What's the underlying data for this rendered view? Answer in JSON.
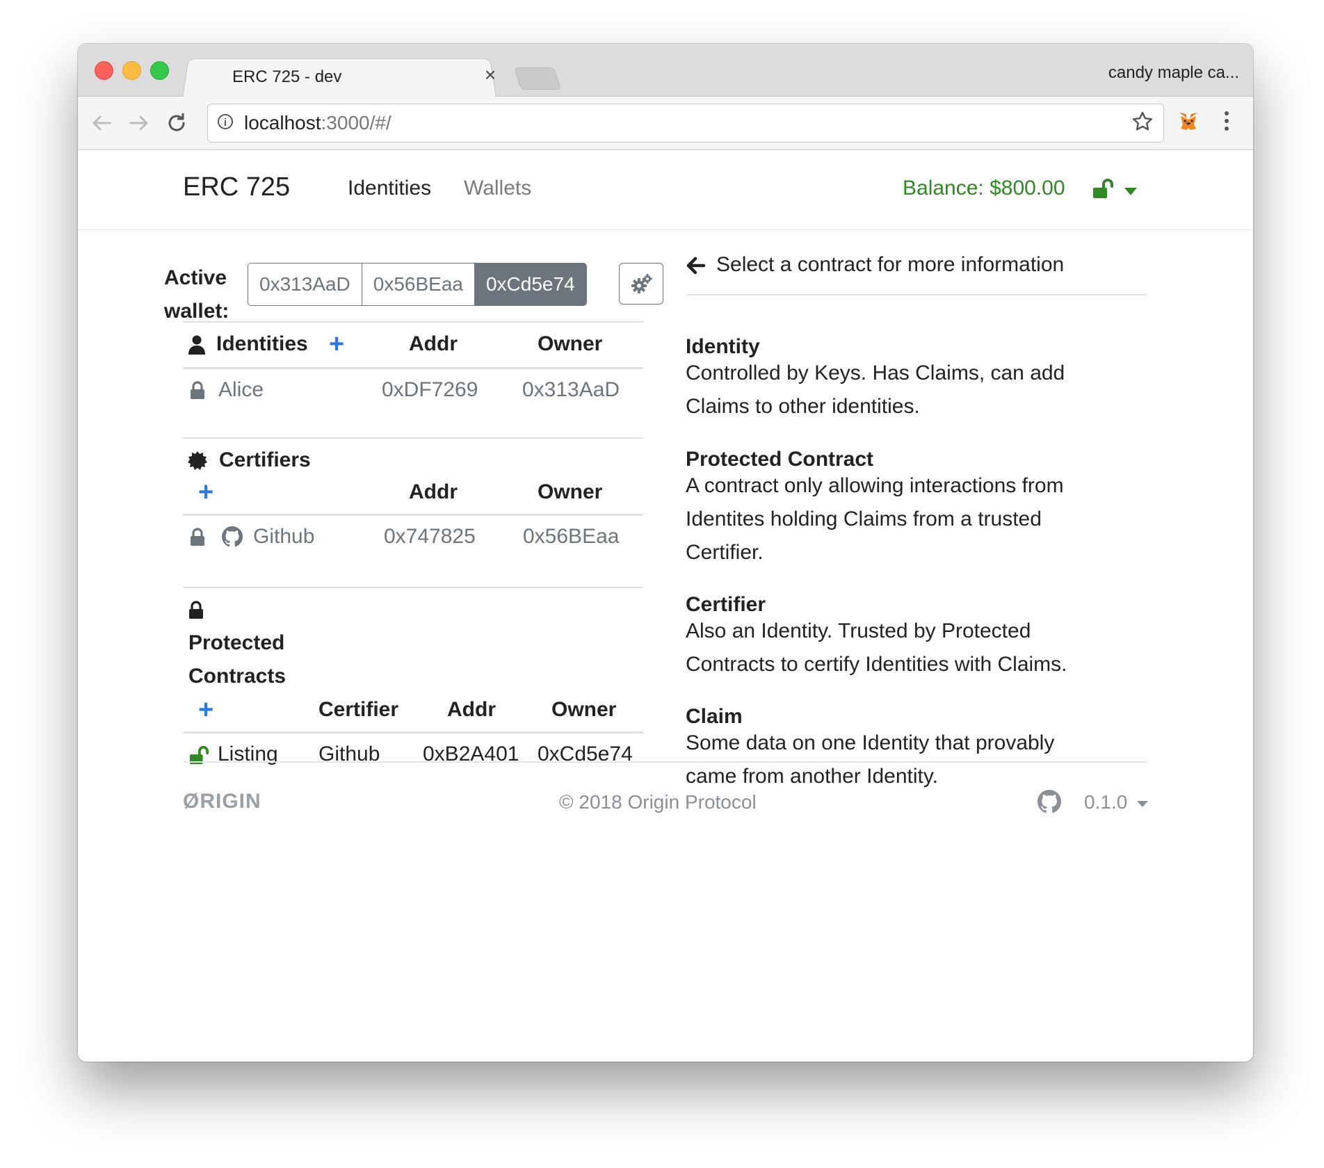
{
  "browser": {
    "tab_title": "ERC 725 - dev",
    "tab_close": "×",
    "profile_name": "candy maple ca...",
    "url_host": "localhost",
    "url_path": ":3000/#/"
  },
  "nav": {
    "brand": "ERC 725",
    "identities": "Identities",
    "wallets": "Wallets",
    "balance": "Balance: $800.00"
  },
  "wallet": {
    "label_line1": "Active",
    "label_line2": "wallet:",
    "options": [
      "0x313AaD",
      "0x56BEaa",
      "0xCd5e74"
    ],
    "active": "0xCd5e74"
  },
  "identities": {
    "heading": "Identities",
    "col_addr": "Addr",
    "col_owner": "Owner",
    "rows": [
      {
        "name": "Alice",
        "addr": "0xDF7269",
        "owner": "0x313AaD"
      }
    ]
  },
  "certifiers": {
    "heading": "Certifiers",
    "col_addr": "Addr",
    "col_owner": "Owner",
    "rows": [
      {
        "name": "Github",
        "addr": "0x747825",
        "owner": "0x56BEaa"
      }
    ]
  },
  "protected": {
    "heading_line1": "Protected",
    "heading_line2": "Contracts",
    "col_certifier": "Certifier",
    "col_addr": "Addr",
    "col_owner": "Owner",
    "rows": [
      {
        "name": "Listing",
        "certifier": "Github",
        "addr": "0xB2A401",
        "owner": "0xCd5e74"
      }
    ]
  },
  "info": {
    "prompt": "Select a contract for more information",
    "items": [
      {
        "title": "Identity",
        "line1": "Controlled by Keys. Has Claims, can add",
        "line2": "Claims to other identities."
      },
      {
        "title": "Protected Contract",
        "line1": "A contract only allowing interactions from",
        "line2": "Identites holding Claims from a trusted",
        "line3": "Certifier."
      },
      {
        "title": "Certifier",
        "line1": "Also an Identity. Trusted by Protected",
        "line2": "Contracts to certify Identities with Claims."
      },
      {
        "title": "Claim",
        "line1": "Some data on one Identity that provably",
        "line2": "came from another Identity."
      }
    ]
  },
  "footer": {
    "logo": "ØRIGIN",
    "copyright": "© 2018  Origin Protocol",
    "version": "0.1.0"
  },
  "colors": {
    "accent_blue": "#2a79e0",
    "balance_green": "#2f8a24",
    "muted_gray": "#6c757d"
  }
}
